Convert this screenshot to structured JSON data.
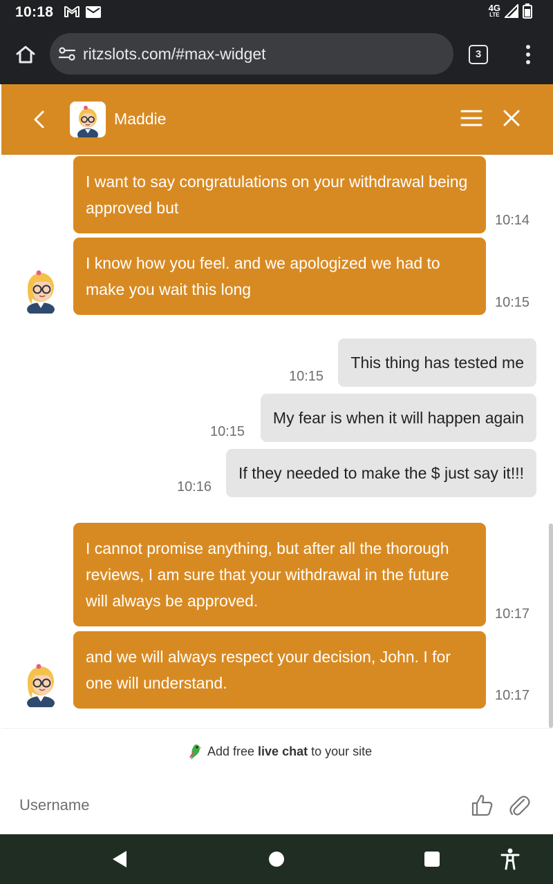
{
  "status_bar": {
    "time": "10:18",
    "left_icons": [
      "gmail-icon",
      "mail-icon"
    ],
    "network": "4G",
    "network_sub": "LTE",
    "right_icons": [
      "signal-icon",
      "battery-icon"
    ]
  },
  "browser": {
    "url": "ritzslots.com/#max-widget",
    "tab_count": "3"
  },
  "chat_header": {
    "agent_name": "Maddie",
    "accent_color": "#d88a22"
  },
  "messages": [
    {
      "sender": "agent",
      "text": "I want to say congratulations on your withdrawal being approved but",
      "time": "10:14"
    },
    {
      "sender": "agent",
      "text": "I know how you feel. and we apologized we had to make you wait this long",
      "time": "10:15"
    },
    {
      "sender": "user",
      "text": "This thing has tested me",
      "time": "10:15"
    },
    {
      "sender": "user",
      "text": "My fear is when it will happen again",
      "time": "10:15"
    },
    {
      "sender": "user",
      "text": "If they needed to make the $ just say it!!!",
      "time": "10:16"
    },
    {
      "sender": "agent",
      "text": "I cannot promise anything, but after all the thorough reviews, I am sure that your withdrawal in the future will always be approved.",
      "time": "10:17"
    },
    {
      "sender": "agent",
      "text": "and we will always respect your decision, John. I for one will understand.",
      "time": "10:17"
    }
  ],
  "footer": {
    "powered_prefix": "Add free ",
    "powered_bold": "live chat",
    "powered_suffix": " to your site",
    "input_placeholder": "Username"
  }
}
